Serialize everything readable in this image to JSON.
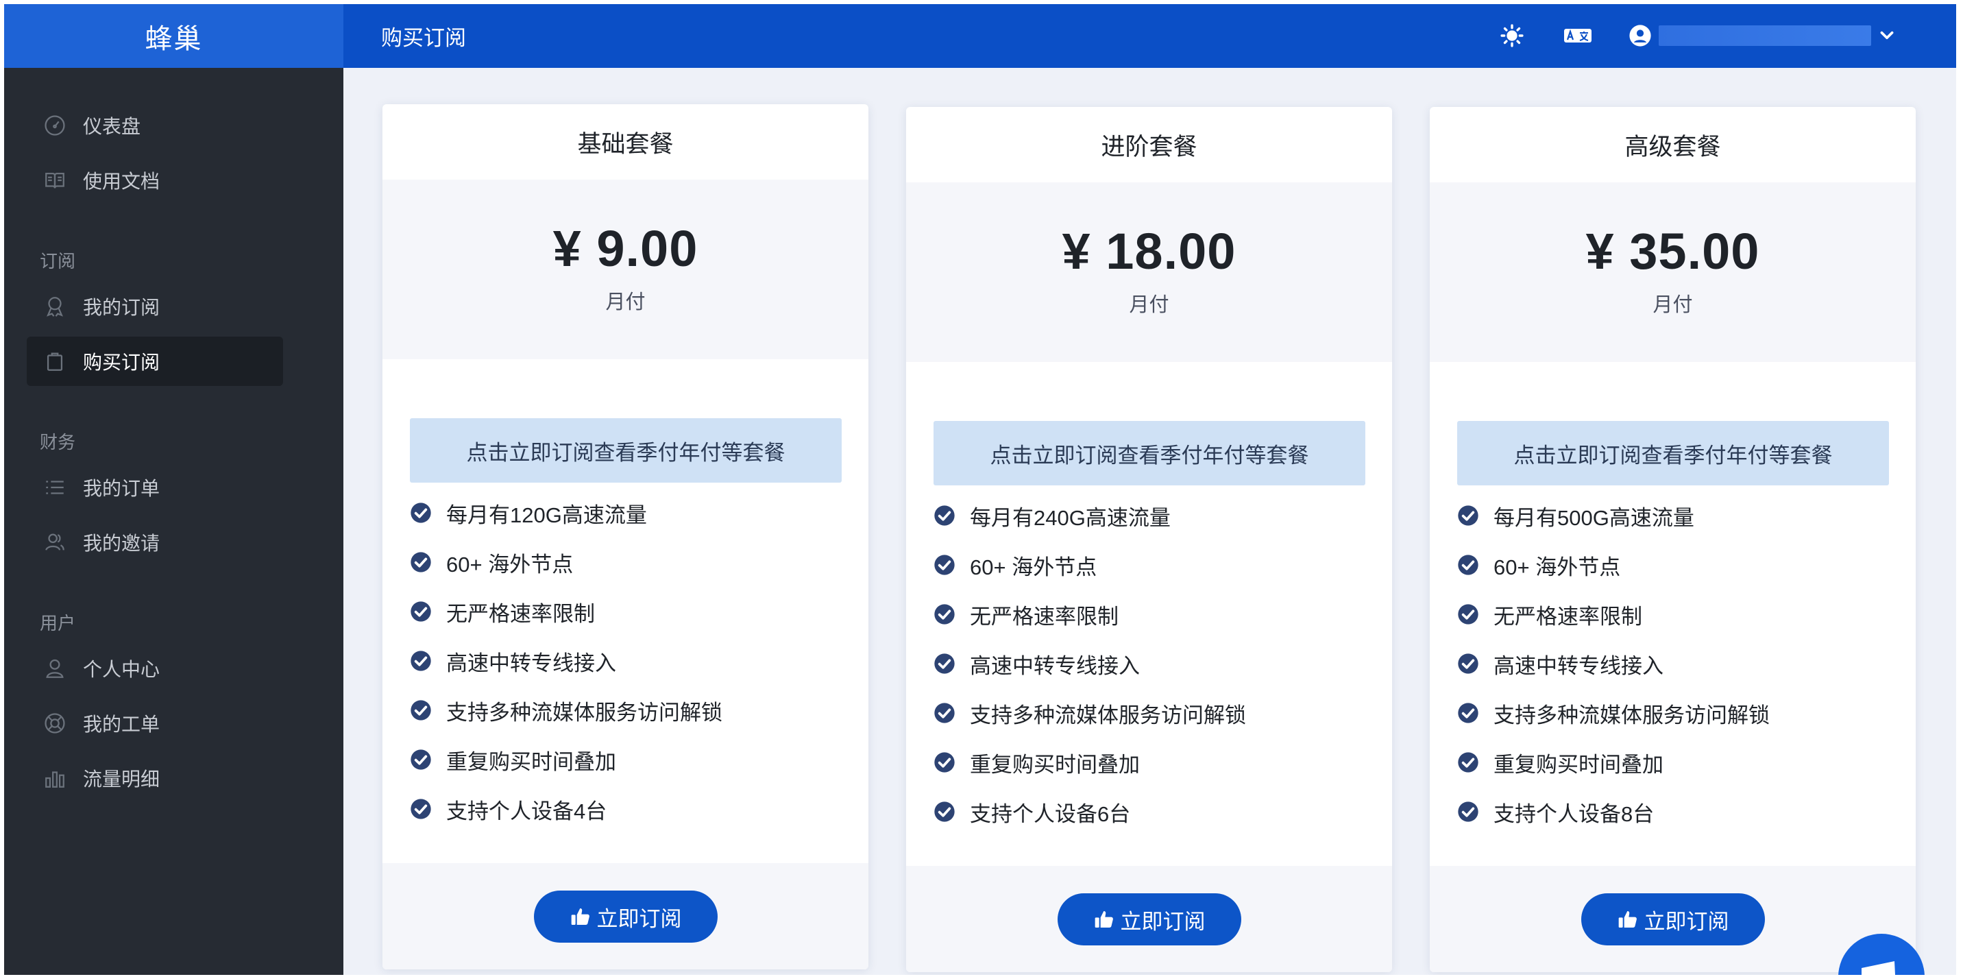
{
  "brand": "蜂巢",
  "header": {
    "title": "购买订阅",
    "icons": [
      "sun-icon",
      "translate-icon",
      "user-circle-icon",
      "chevron-down-icon"
    ]
  },
  "sidebar": {
    "items": [
      {
        "label": "仪表盘",
        "icon": "gauge-icon"
      },
      {
        "label": "使用文档",
        "icon": "book-icon"
      },
      {
        "label": "我的订阅",
        "icon": "award-icon"
      },
      {
        "label": "购买订阅",
        "icon": "bag-icon",
        "active": true
      },
      {
        "label": "我的订单",
        "icon": "list-icon"
      },
      {
        "label": "我的邀请",
        "icon": "users-icon"
      },
      {
        "label": "个人中心",
        "icon": "user-icon"
      },
      {
        "label": "我的工单",
        "icon": "lifebuoy-icon"
      },
      {
        "label": "流量明细",
        "icon": "bar-chart-icon"
      }
    ],
    "sections": [
      "订阅",
      "财务",
      "用户"
    ]
  },
  "plans": [
    {
      "name": "基础套餐",
      "price": "¥ 9.00",
      "period": "月付",
      "note": "点击立即订阅查看季付年付等套餐",
      "features": [
        "每月有120G高速流量",
        "60+ 海外节点",
        "无严格速率限制",
        "高速中转专线接入",
        "支持多种流媒体服务访问解锁",
        "重复购买时间叠加",
        "支持个人设备4台"
      ],
      "button": "立即订阅"
    },
    {
      "name": "进阶套餐",
      "price": "¥ 18.00",
      "period": "月付",
      "note": "点击立即订阅查看季付年付等套餐",
      "features": [
        "每月有240G高速流量",
        "60+ 海外节点",
        "无严格速率限制",
        "高速中转专线接入",
        "支持多种流媒体服务访问解锁",
        "重复购买时间叠加",
        "支持个人设备6台"
      ],
      "button": "立即订阅"
    },
    {
      "name": "高级套餐",
      "price": "¥ 35.00",
      "period": "月付",
      "note": "点击立即订阅查看季付年付等套餐",
      "features": [
        "每月有500G高速流量",
        "60+ 海外节点",
        "无严格速率限制",
        "高速中转专线接入",
        "支持多种流媒体服务访问解锁",
        "重复购买时间叠加",
        "支持个人设备8台"
      ],
      "button": "立即订阅"
    }
  ],
  "colors": {
    "brand": "#1e63d6",
    "topbar": "#0b4fc6",
    "sidebar": "#262b33",
    "check": "#2d4373",
    "button": "#0d55c8"
  }
}
